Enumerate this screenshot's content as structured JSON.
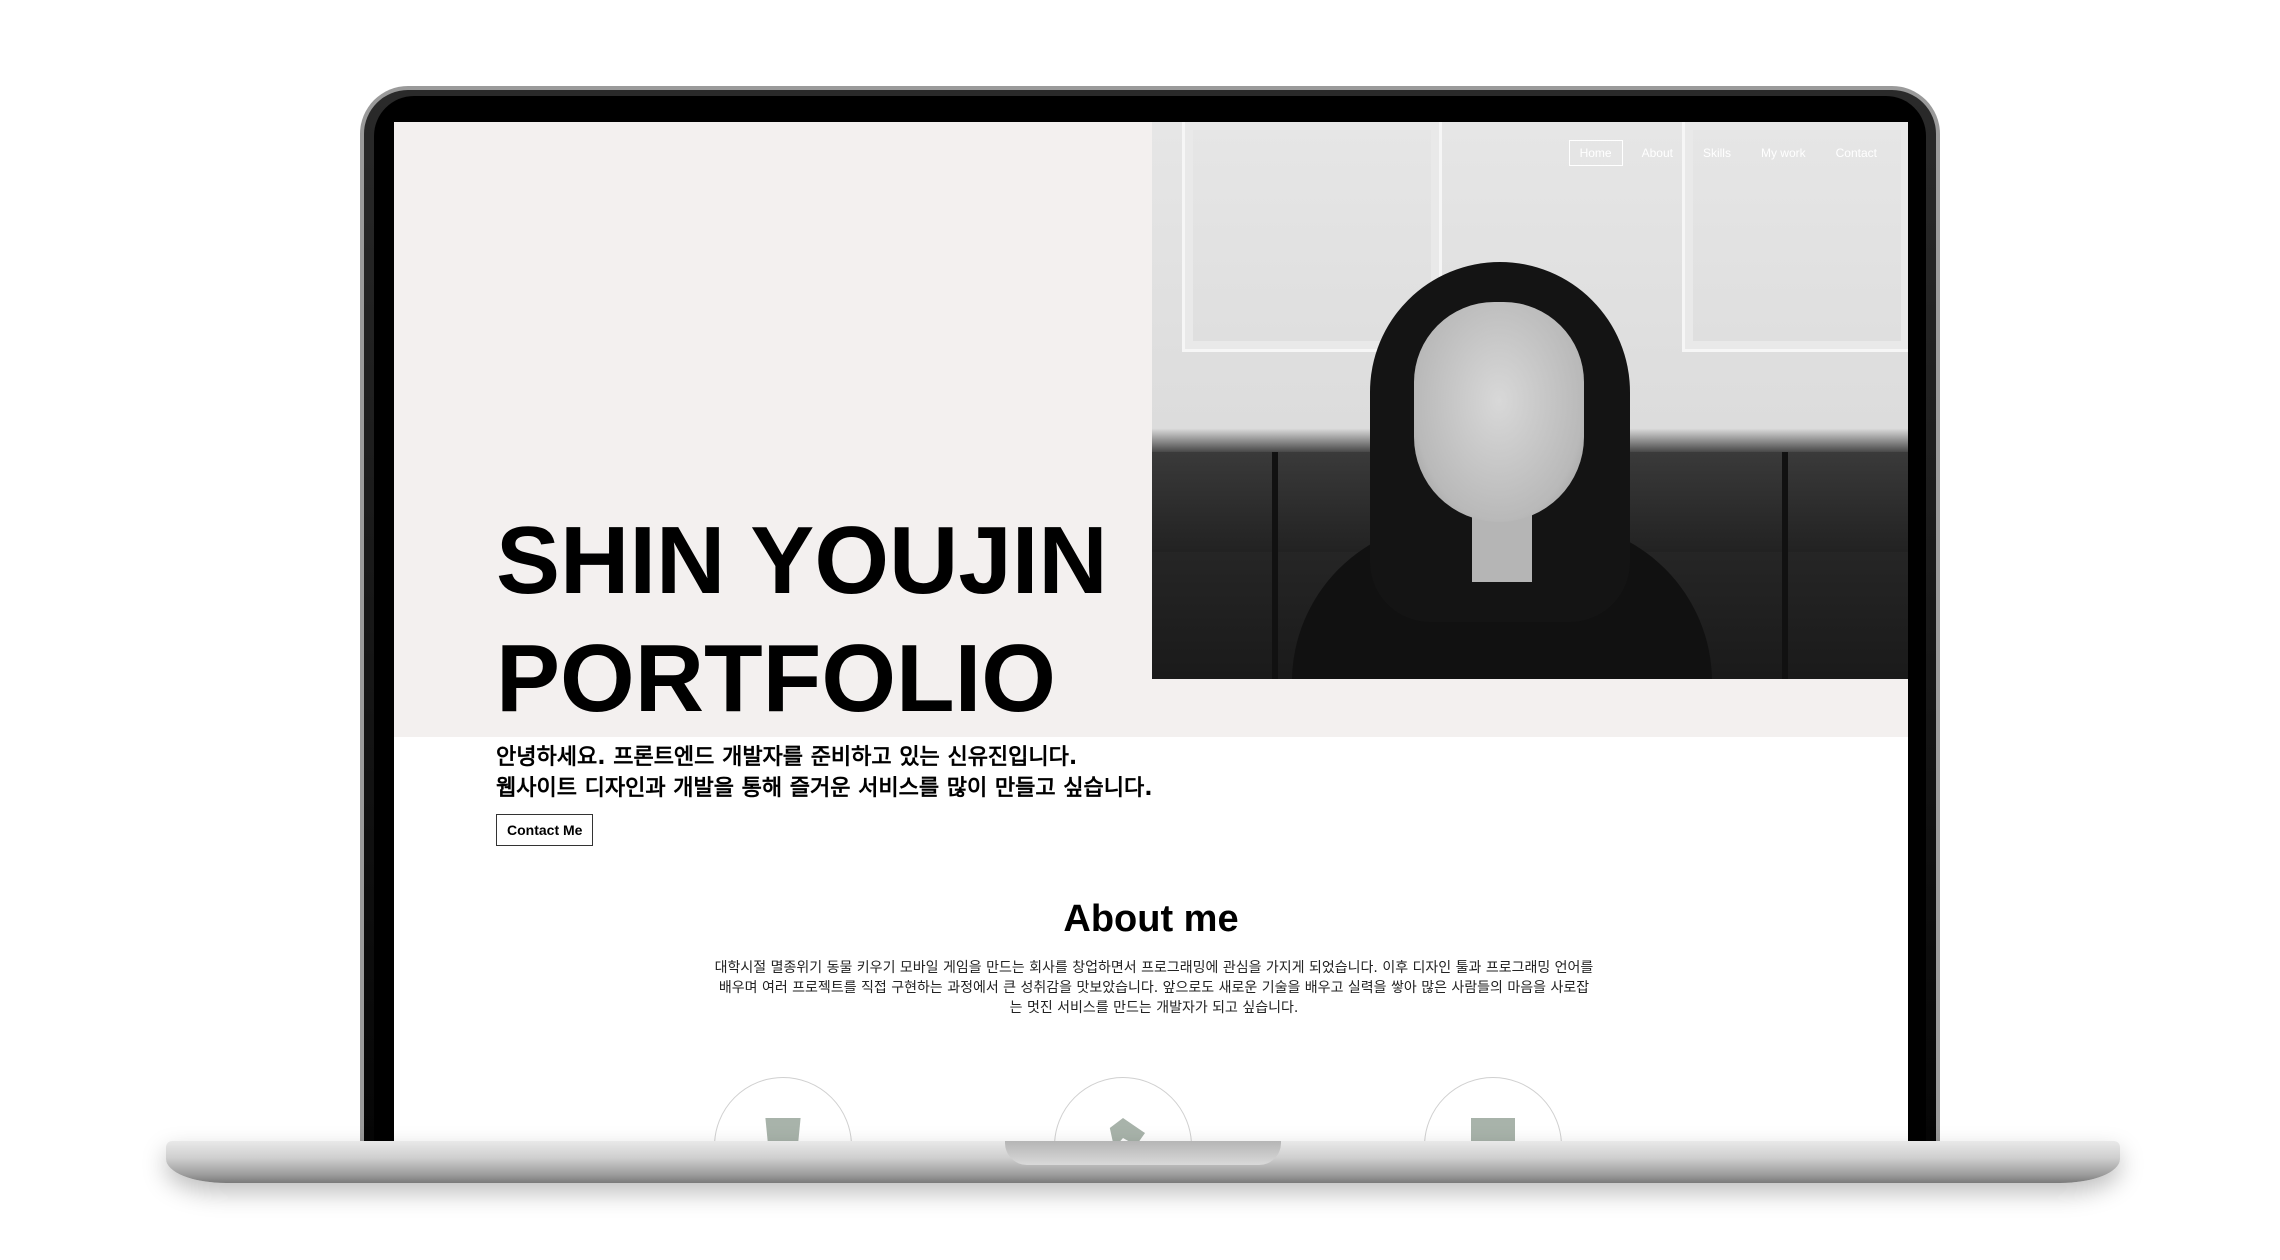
{
  "nav": {
    "items": [
      "Home",
      "About",
      "Skills",
      "My work",
      "Contact"
    ],
    "active": "Home"
  },
  "hero": {
    "title_line1": "SHIN YOUJIN",
    "title_line2": "PORTFOLIO",
    "intro_line1": "안녕하세요. 프론트엔드 개발자를 준비하고 있는 신유진입니다.",
    "intro_line2": "웹사이트 디자인과 개발을 통해 즐거운 서비스를 많이 만들고 싶습니다.",
    "contact_button": "Contact Me"
  },
  "about": {
    "title": "About me",
    "text": "대학시절 멸종위기 동물 키우기 모바일 게임을 만드는 회사를 창업하면서 프로그래밍에 관심을 가지게 되었습니다. 이후 디자인 툴과 프로그래밍 언어를 배우며 여러 프로젝트를 직접 구현하는 과정에서 큰 성취감을 맛보았습니다. 앞으로도 새로운 기술을 배우고 실력을 쌓아 많은 사람들의 마음을 사로잡는 멋진 서비스를 만드는 개발자가 되고 싶습니다."
  },
  "icons": [
    "html5-icon",
    "handshake-icon",
    "square-icon"
  ],
  "colors": {
    "hero_background": "#f3f0ef",
    "icon_tint": "#a8b3aa"
  }
}
